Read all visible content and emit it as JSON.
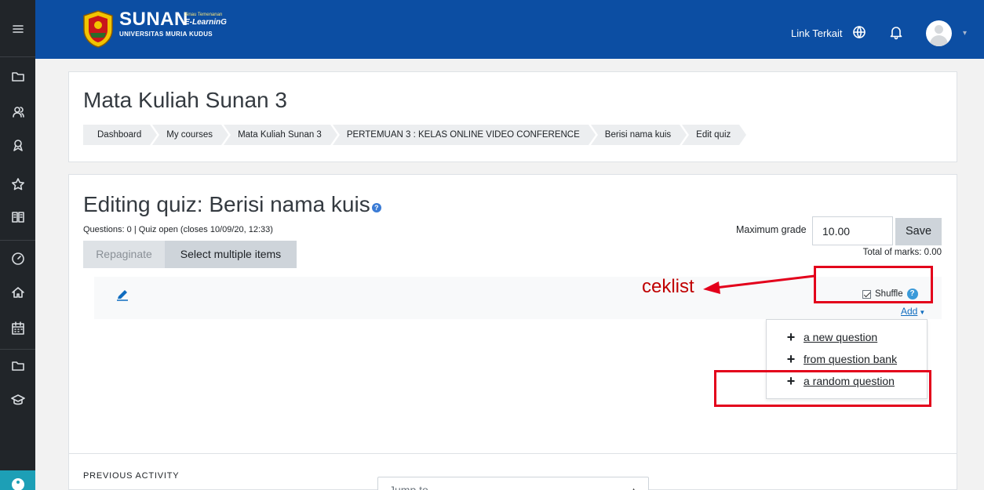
{
  "topbar": {
    "brand_name": "SUNAN",
    "brand_tagline": "Sinau Temenanan",
    "brand_sub": "E-LearninG",
    "brand_university": "UNIVERSITAS MURIA KUDUS",
    "link_terkait": "Link Terkait",
    "bg_color": "#0c4ea3"
  },
  "course": {
    "title": "Mata Kuliah Sunan 3",
    "breadcrumbs": [
      "Dashboard",
      "My courses",
      "Mata Kuliah Sunan 3",
      "PERTEMUAN 3 : KELAS ONLINE VIDEO CONFERENCE",
      "Berisi nama kuis",
      "Edit quiz"
    ]
  },
  "quiz": {
    "title": "Editing quiz: Berisi nama kuis",
    "info": "Questions: 0 | Quiz open (closes 10/09/20, 12:33)",
    "repaginate_label": "Repaginate",
    "select_multiple_label": "Select multiple items",
    "max_grade_label": "Maximum grade",
    "max_grade_value": "10.00",
    "save_label": "Save",
    "total_marks": "Total of marks: 0.00",
    "shuffle_label": "Shuffle",
    "shuffle_checked": true,
    "add_label": "Add",
    "add_menu": [
      "a new question",
      "from question bank",
      "a random question"
    ]
  },
  "footer": {
    "previous_activity": "PREVIOUS ACTIVITY",
    "jump_to": "Jump to..."
  },
  "annotation": {
    "ceklist_text": "ceklist",
    "highlight_color": "#e3001b"
  }
}
